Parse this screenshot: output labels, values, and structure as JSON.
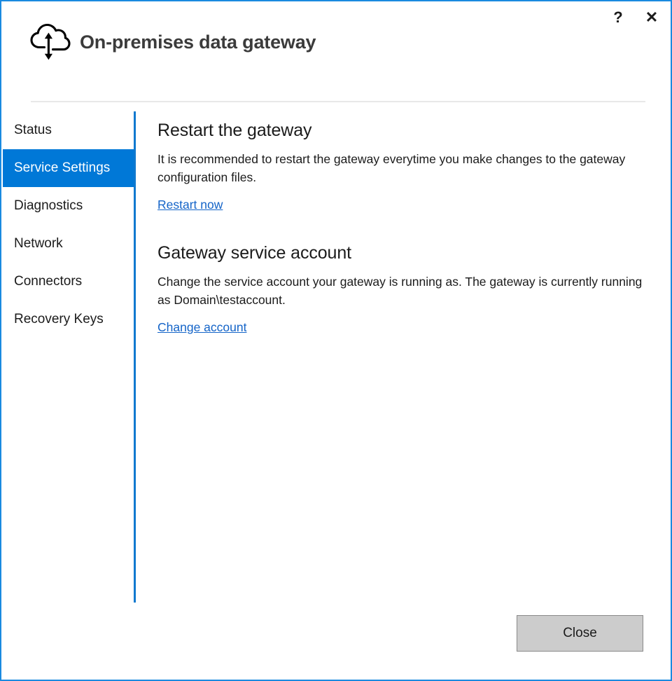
{
  "window": {
    "border_color": "#1a8ae0",
    "title": "On-premises data gateway",
    "icon": "cloud-updown-arrow-icon"
  },
  "titlebar": {
    "help_label": "?",
    "help_icon": "question-mark-icon",
    "close_label": "✕",
    "close_icon": "close-x-icon"
  },
  "sidebar": {
    "selected_index": 1,
    "selected_color": "#0078d7",
    "items": [
      {
        "label": "Status",
        "selected": false
      },
      {
        "label": "Service Settings",
        "selected": true
      },
      {
        "label": "Diagnostics",
        "selected": false
      },
      {
        "label": "Network",
        "selected": false
      },
      {
        "label": "Connectors",
        "selected": false
      },
      {
        "label": "Recovery Keys",
        "selected": false
      }
    ]
  },
  "main": {
    "link_color": "#1464c8",
    "sections": [
      {
        "heading": "Restart the gateway",
        "body": "It is recommended to restart the gateway everytime you make changes to the gateway configuration files.",
        "link": "Restart now"
      },
      {
        "heading": "Gateway service account",
        "body": "Change the service account your gateway is running as. The gateway is currently running as Domain\\testaccount.",
        "link": "Change account"
      }
    ]
  },
  "footer": {
    "close_label": "Close"
  }
}
